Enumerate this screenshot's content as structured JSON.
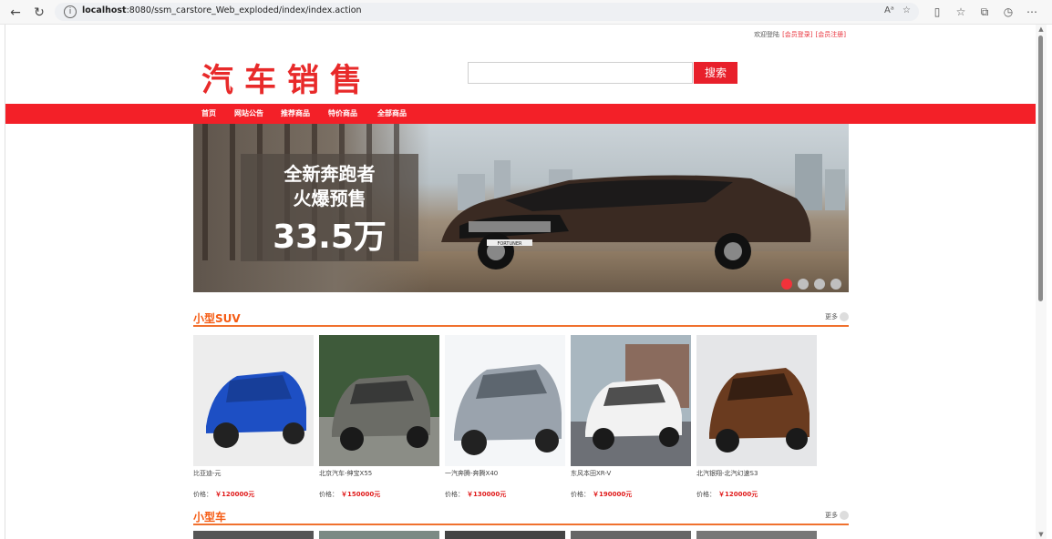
{
  "browser": {
    "url_host": "localhost",
    "url_rest": ":8080/ssm_carstore_Web_exploded/index/index.action",
    "read_aloud": "Aᵃ"
  },
  "header": {
    "welcome": "欢迎登陆",
    "login_link": "[会员登录]",
    "register_link": "[会员注册]",
    "logo_text": "汽车销售"
  },
  "search": {
    "placeholder": "",
    "button_label": "搜索"
  },
  "nav": {
    "items": [
      "首页",
      "网站公告",
      "推荐商品",
      "特价商品",
      "全部商品"
    ]
  },
  "banner": {
    "line1": "全新奔跑者",
    "line2": "火爆预售",
    "line3": "33.5万",
    "plate": "FORTUNER",
    "dot_count": 4,
    "active_dot": 0
  },
  "sections": [
    {
      "title": "小型SUV",
      "more": "更多"
    },
    {
      "title": "小型车",
      "more": "更多"
    }
  ],
  "price_label": "价格：",
  "products": [
    {
      "name": "比亚迪-元",
      "price": "￥120000元",
      "color": "#1d4fc4"
    },
    {
      "name": "北京汽车-绅宝X55",
      "price": "￥150000元",
      "color": "#6b6c66"
    },
    {
      "name": "一汽奔腾-奔腾X40",
      "price": "￥130000元",
      "color": "#9aa3ad"
    },
    {
      "name": "东风本田XR-V",
      "price": "￥190000元",
      "color": "#f2f2f2"
    },
    {
      "name": "北汽银翔-北汽幻速S3",
      "price": "￥120000元",
      "color": "#6a3b1f"
    }
  ]
}
